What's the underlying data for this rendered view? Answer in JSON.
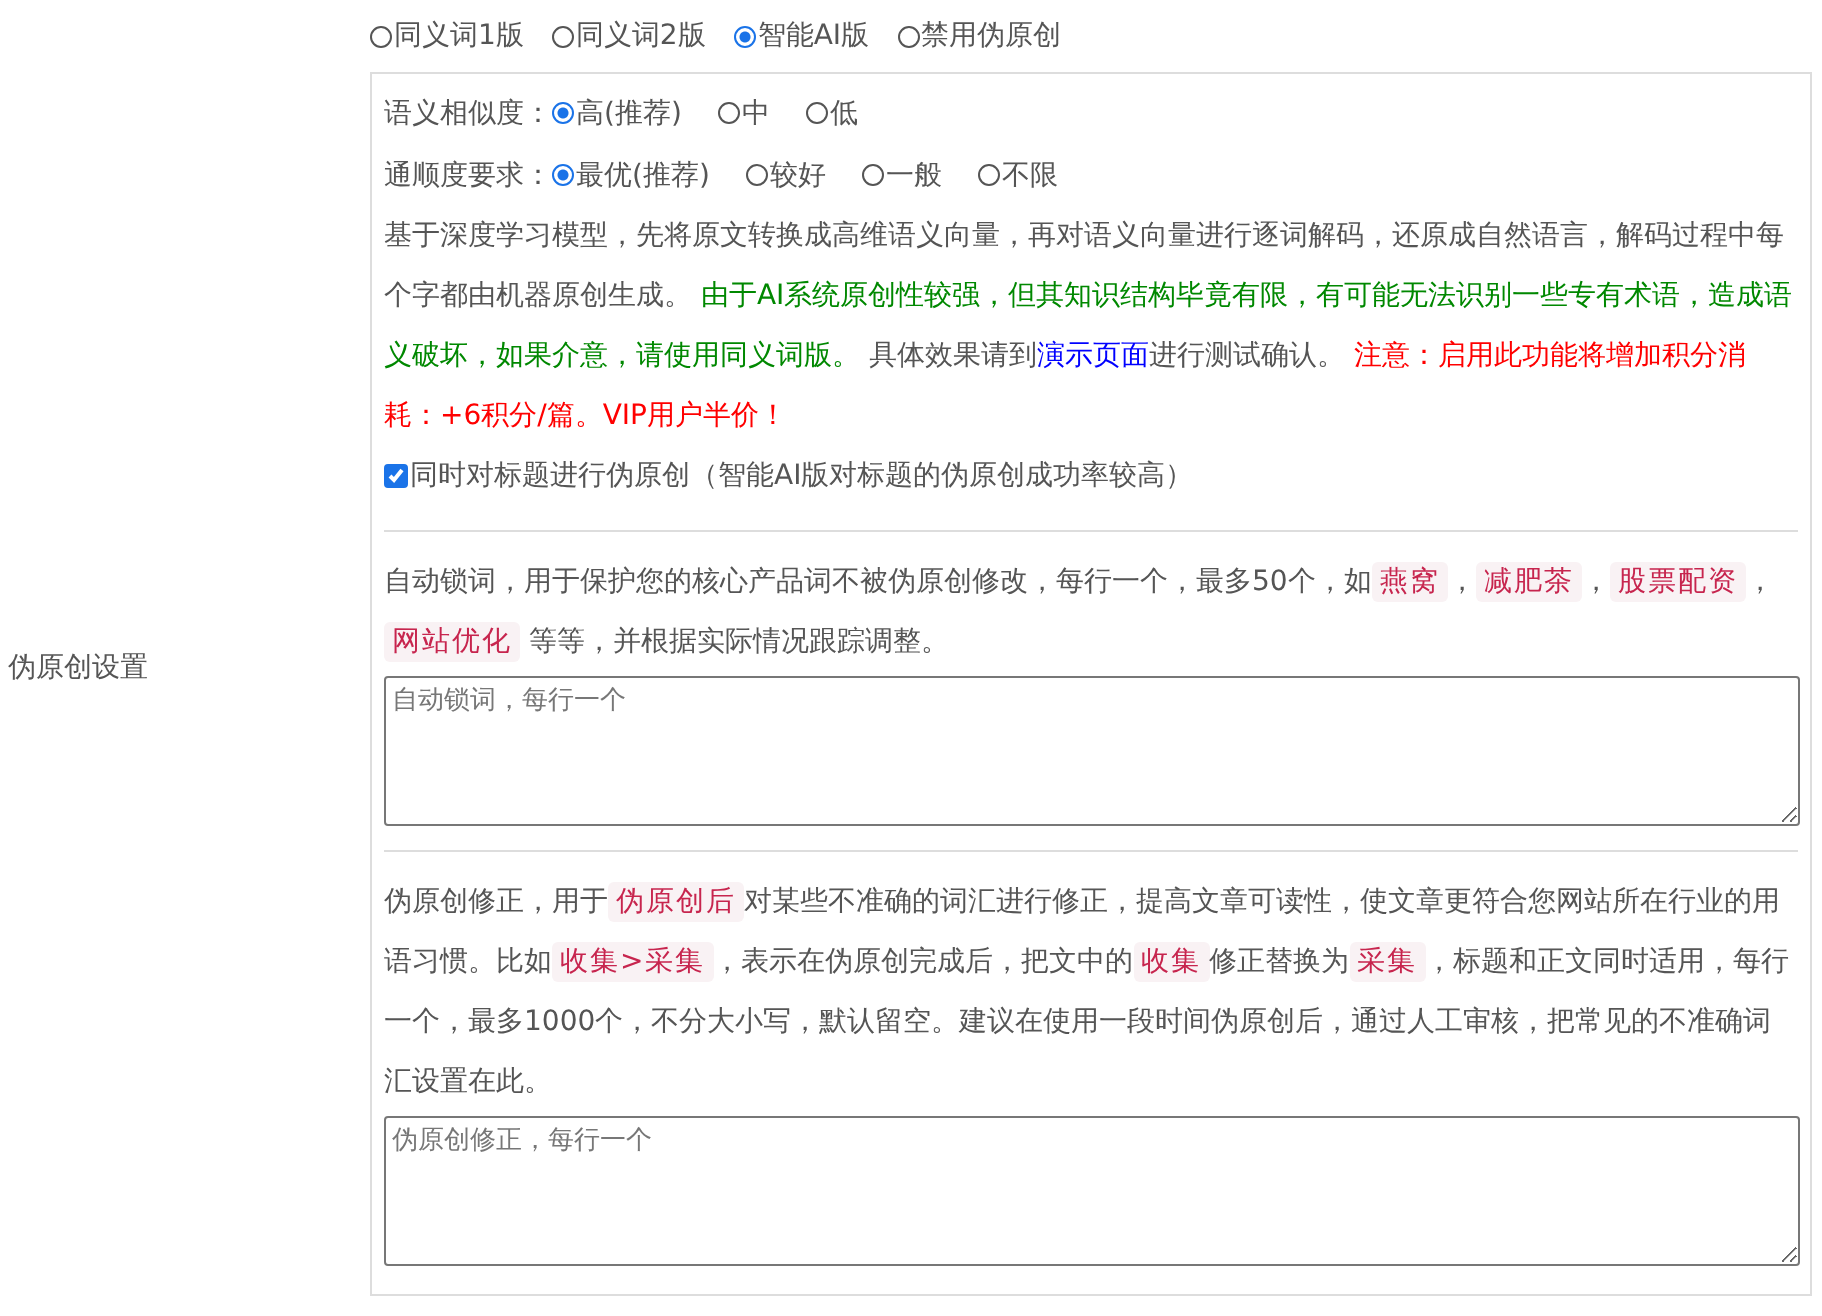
{
  "section_label": "伪原创设置",
  "modes": [
    {
      "label": "同义词1版",
      "selected": false
    },
    {
      "label": "同义词2版",
      "selected": false
    },
    {
      "label": "智能AI版",
      "selected": true
    },
    {
      "label": "禁用伪原创",
      "selected": false
    }
  ],
  "ai_options": [
    {
      "label": "语义相似度：",
      "options": [
        {
          "label": "高(推荐)",
          "selected": true
        },
        {
          "label": "中",
          "selected": false
        },
        {
          "label": "低",
          "selected": false
        }
      ]
    },
    {
      "label": "通顺度要求：",
      "options": [
        {
          "label": "最优(推荐)",
          "selected": true
        },
        {
          "label": "较好",
          "selected": false
        },
        {
          "label": "一般",
          "selected": false
        },
        {
          "label": "不限",
          "selected": false
        }
      ]
    }
  ],
  "ai_description": [
    {
      "kind": "text",
      "text": "基于深度学习模型，先将原文转换成高维语义向量，再对语义向量进行逐词解码，还原成自然语言，解码过程中每个字都由机器原创生成。 "
    },
    {
      "kind": "notice",
      "text": "由于AI系统原创性较强，但其知识结构毕竟有限，有可能无法识别一些专有术语，造成语义破坏，如果介意，请使用同义词版。"
    },
    {
      "kind": "text",
      "text": " 具体效果请到"
    },
    {
      "kind": "link",
      "text": "演示页面"
    },
    {
      "kind": "text",
      "text": "进行测试确认。 "
    },
    {
      "kind": "warning",
      "text": "注意：启用此功能将增加积分消耗：+6积分/篇。VIP用户半价！"
    }
  ],
  "title_option": {
    "label": "同时对标题进行伪原创（智能AI版对标题的伪原创成功率较高）",
    "checked": true
  },
  "lock_words": {
    "description": [
      {
        "kind": "text",
        "text": "自动锁词，用于保护您的核心产品词不被伪原创修改，每行一个，最多50个，如"
      },
      {
        "kind": "code",
        "text": "燕窝"
      },
      {
        "kind": "text",
        "text": "，"
      },
      {
        "kind": "code",
        "text": "减肥茶"
      },
      {
        "kind": "text",
        "text": "，"
      },
      {
        "kind": "code",
        "text": "股票配资"
      },
      {
        "kind": "text",
        "text": "，"
      },
      {
        "kind": "code",
        "text": "网站优化"
      },
      {
        "kind": "text",
        "text": " 等等，并根据实际情况跟踪调整。"
      }
    ],
    "placeholder": "自动锁词，每行一个"
  },
  "corrections": {
    "description": [
      {
        "kind": "text",
        "text": "伪原创修正，用于"
      },
      {
        "kind": "code",
        "text": "伪原创后"
      },
      {
        "kind": "text",
        "text": "对某些不准确的词汇进行修正，提高文章可读性，使文章更符合您网站所在行业的用语习惯。比如"
      },
      {
        "kind": "code",
        "text": "收集>采集"
      },
      {
        "kind": "text",
        "text": "，表示在伪原创完成后，把文中的"
      },
      {
        "kind": "code",
        "text": "收集"
      },
      {
        "kind": "text",
        "text": "修正替换为"
      },
      {
        "kind": "code",
        "text": "采集"
      },
      {
        "kind": "text",
        "text": "，标题和正文同时适用，每行一个，最多1000个，不分大小写，默认留空。建议在使用一段时间伪原创后，通过人工审核，把常见的不准确词汇设置在此。"
      }
    ],
    "placeholder": "伪原创修正，每行一个"
  }
}
